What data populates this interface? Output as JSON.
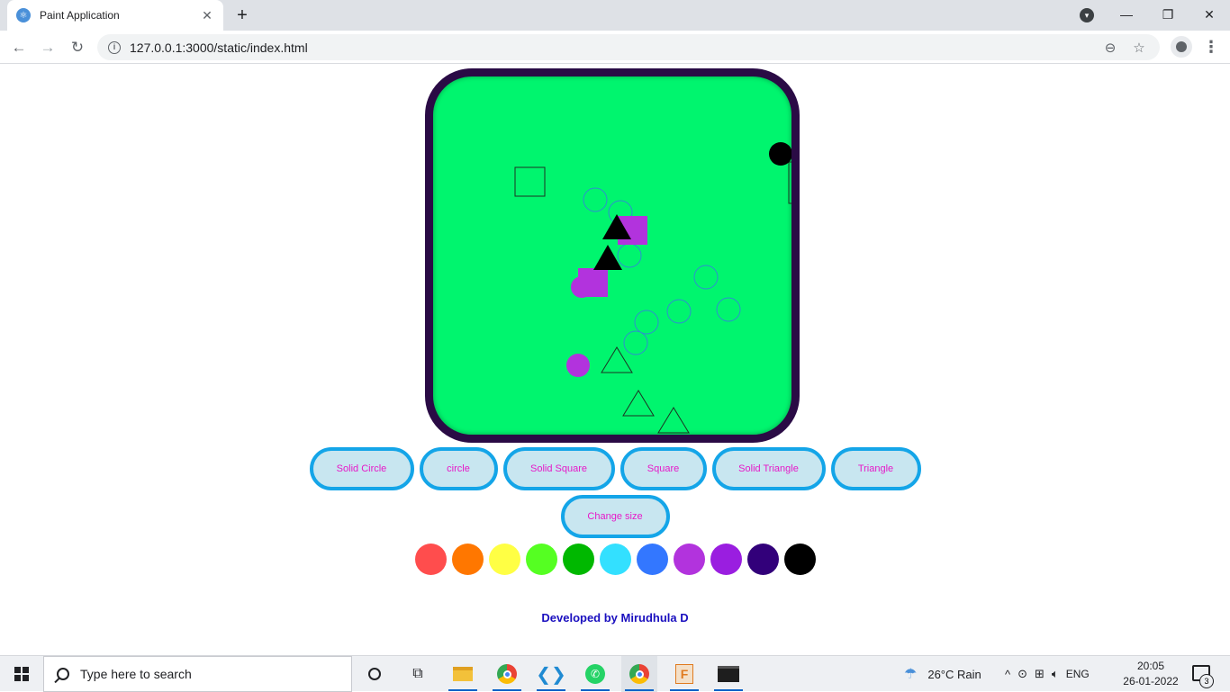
{
  "browser": {
    "tab_title": "Paint Application",
    "url": "127.0.0.1:3000/static/index.html"
  },
  "page": {
    "buttons_row1": [
      {
        "label": "Solid Circle",
        "name": "solid-circle-button"
      },
      {
        "label": "circle",
        "name": "circle-button"
      },
      {
        "label": "Solid Square",
        "name": "solid-square-button"
      },
      {
        "label": "Square",
        "name": "square-button"
      },
      {
        "label": "Solid Triangle",
        "name": "solid-triangle-button"
      },
      {
        "label": "Triangle",
        "name": "triangle-button"
      }
    ],
    "change_size_label": "Change size",
    "palette": [
      "#ff4d4d",
      "#ff7700",
      "#ffff44",
      "#55ff22",
      "#00b800",
      "#33e0ff",
      "#3377ff",
      "#b233dd",
      "#9a1ee0",
      "#32007a",
      "#000000"
    ],
    "credit": "Developed by Mirudhula D",
    "canvas_color": "#00f56e",
    "frame_color": "#2a0b45",
    "button_border_color": "#14a5e8",
    "button_text_color": "#e619c8"
  },
  "taskbar": {
    "search_placeholder": "Type here to search",
    "weather": "26°C  Rain",
    "language": "ENG",
    "time": "20:05",
    "date": "26-01-2022",
    "notification_count": "3"
  }
}
